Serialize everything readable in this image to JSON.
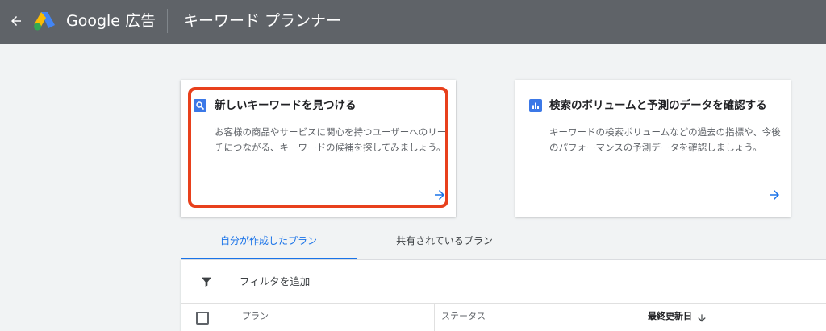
{
  "header": {
    "back_label": "戻る",
    "brand": "Google 広告",
    "tool_title": "キーワード プランナー"
  },
  "cards": [
    {
      "icon": "search-icon",
      "title": "新しいキーワードを見つける",
      "description": "お客様の商品やサービスに関心を持つユーザーへのリーチにつながる、キーワードの候補を探してみましょう。",
      "highlighted": true
    },
    {
      "icon": "bar-chart-icon",
      "title": "検索のボリュームと予測のデータを確認する",
      "description": "キーワードの検索ボリュームなどの過去の指標や、今後のパフォーマンスの予測データを確認しましょう。",
      "highlighted": false
    }
  ],
  "tabs": [
    {
      "label": "自分が作成したプラン",
      "active": true
    },
    {
      "label": "共有されているプラン",
      "active": false
    }
  ],
  "filter": {
    "label": "フィルタを追加"
  },
  "table": {
    "columns": [
      "プラン",
      "ステータス",
      "最終更新日"
    ],
    "sort_column": "最終更新日",
    "sort_direction": "descending"
  },
  "colors": {
    "topbar": "#5f6368",
    "accent": "#1a73e8",
    "highlight": "#e8401c",
    "icon_blue": "#3b78e7"
  }
}
